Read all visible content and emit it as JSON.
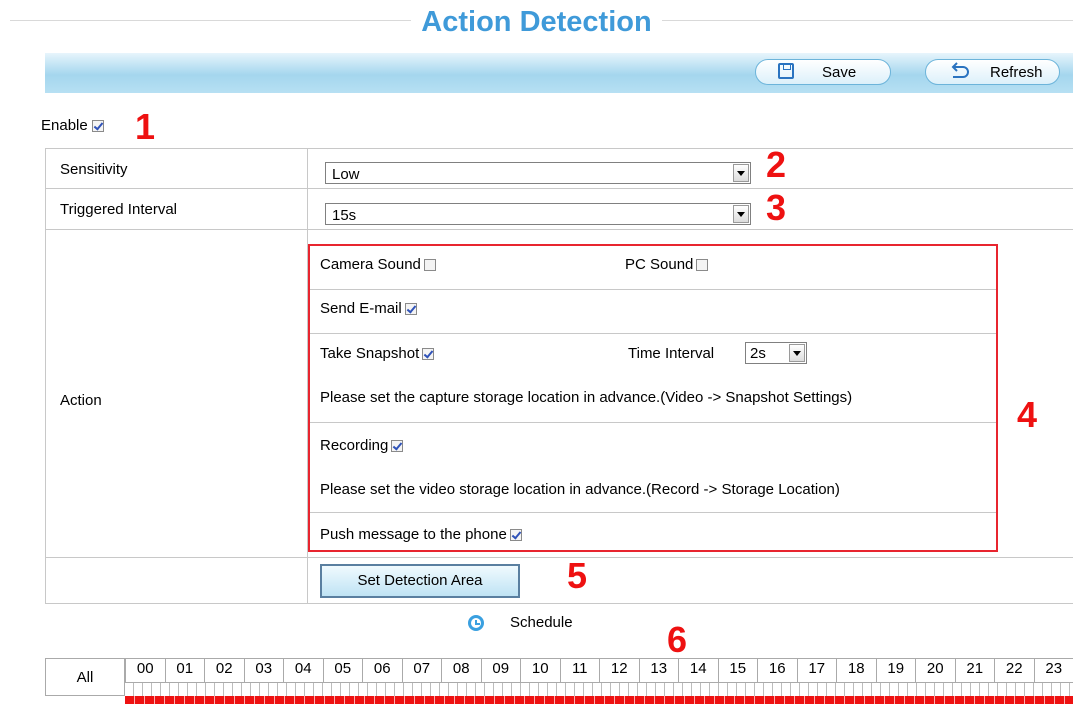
{
  "page": {
    "title": "Action Detection"
  },
  "toolbar": {
    "save_label": "Save",
    "refresh_label": "Refresh"
  },
  "enable": {
    "label": "Enable",
    "checked": true,
    "marker": "1"
  },
  "sensitivity": {
    "label": "Sensitivity",
    "value": "Low",
    "marker": "2"
  },
  "triggered_interval": {
    "label": "Triggered Interval",
    "value": "15s",
    "marker": "3"
  },
  "action": {
    "label": "Action",
    "marker": "4",
    "camera_sound": "Camera Sound",
    "pc_sound": "PC Sound",
    "send_email": "Send E-mail",
    "take_snapshot": "Take Snapshot",
    "time_interval_label": "Time Interval",
    "time_interval_value": "2s",
    "snapshot_note": "Please set the capture storage location in advance.(Video -> Snapshot Settings)",
    "recording": "Recording",
    "recording_note": "Please set the video storage location in advance.(Record -> Storage Location)",
    "push_message": "Push message to the phone"
  },
  "detection_area": {
    "button_label": "Set Detection Area",
    "marker": "5"
  },
  "schedule": {
    "label": "Schedule",
    "marker": "6",
    "all_label": "All",
    "hours": [
      "00",
      "01",
      "02",
      "03",
      "04",
      "05",
      "06",
      "07",
      "08",
      "09",
      "10",
      "11",
      "12",
      "13",
      "14",
      "15",
      "16",
      "17",
      "18",
      "19",
      "20",
      "21",
      "22",
      "23"
    ]
  },
  "colors": {
    "title": "#3f9ad9",
    "marker": "#ee1111",
    "highlight_box": "#e8252f"
  }
}
